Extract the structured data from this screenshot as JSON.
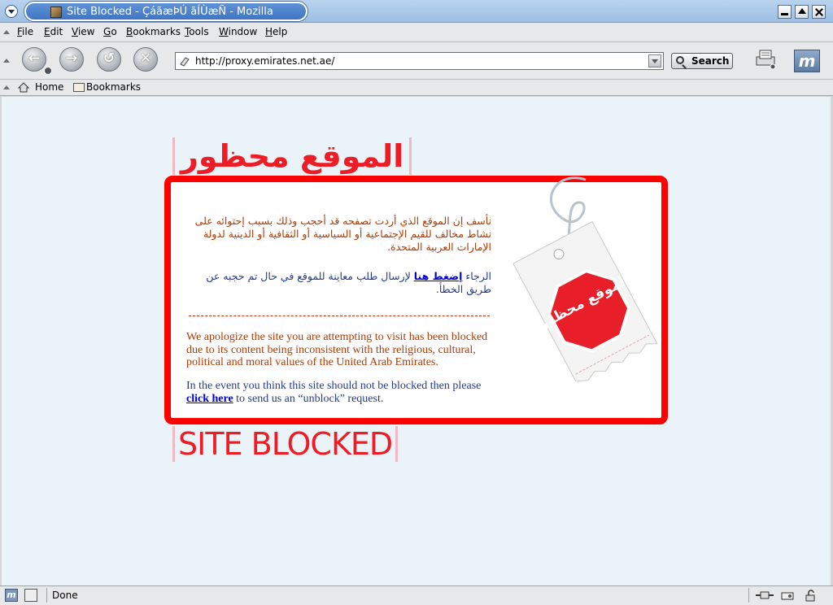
{
  "window": {
    "title": "Site Blocked - ÇáãæÞÚ ãÍÙæÑ - Mozilla"
  },
  "menu": {
    "items": [
      {
        "accel": "F",
        "rest": "ile"
      },
      {
        "accel": "E",
        "rest": "dit"
      },
      {
        "accel": "V",
        "rest": "iew"
      },
      {
        "accel": "G",
        "rest": "o"
      },
      {
        "accel": "B",
        "rest": "ookmarks"
      },
      {
        "accel": "T",
        "rest": "ools"
      },
      {
        "accel": "W",
        "rest": "indow"
      },
      {
        "accel": "H",
        "rest": "elp"
      }
    ]
  },
  "toolbar": {
    "url": "http://proxy.emirates.net.ae/",
    "search_label": "Search"
  },
  "personal_toolbar": {
    "home_label": "Home",
    "bookmarks_label": "Bookmarks"
  },
  "page": {
    "heading_ar": "الموقع محظور",
    "heading_en": "SITE BLOCKED",
    "tag_text": "الموقع محظور",
    "ar_para1": "نأسف إن الموقع الذي أردت تصفحه قد أحجب وذلك بسبب إحتوائه على نشاط مخالف للقيم الإجتماعية أو السياسية أو الثقافية أو الدينية لدولة الإمارات العربية المتحدة.",
    "ar_para2_before": "الرجاء ",
    "ar_link": "إضغط هنا",
    "ar_para2_after": " لإرسال طلب معاينة للموقع في حال تم حجبه عن طريق الخطأ.",
    "en_para1": "We apologize the site you are attempting to visit has been blocked due to its content being inconsistent with the religious, cultural, political and moral values of the United Arab Emirates.",
    "en_para2_before": "In the event you think this site should not be blocked then please",
    "en_link": "click here",
    "en_para2_after": " to send us an “unblock” request."
  },
  "status": {
    "text": "Done"
  },
  "colors": {
    "accent_red": "#ff0000",
    "content_bg": "#eaf3f8",
    "link": "#0000cc"
  }
}
